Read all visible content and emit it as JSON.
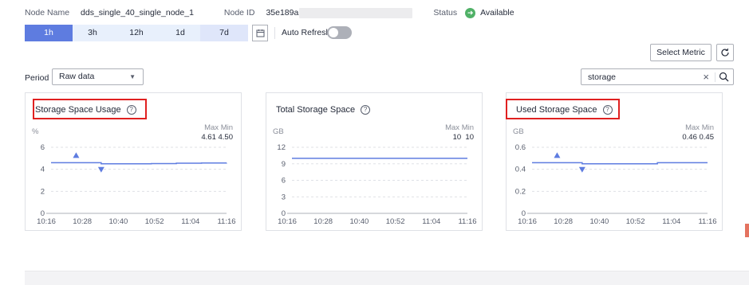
{
  "node": {
    "name_label": "Node Name",
    "name_value": "dds_single_40_single_node_1",
    "id_label": "Node ID",
    "id_value": "35e189a",
    "status_label": "Status",
    "status_value": "Available",
    "status_color": "#50b167"
  },
  "time_tabs": [
    {
      "label": "1h",
      "active": true
    },
    {
      "label": "3h",
      "active": false
    },
    {
      "label": "12h",
      "active": false
    },
    {
      "label": "1d",
      "active": false
    },
    {
      "label": "7d",
      "active": false
    }
  ],
  "auto_refresh": {
    "label": "Auto Refresh",
    "on": false
  },
  "toolbar": {
    "select_metric": "Select Metric",
    "refresh_icon": "refresh-icon"
  },
  "period": {
    "label": "Period",
    "value": "Raw data"
  },
  "search": {
    "value": "storage"
  },
  "accent_color": "#5e7ce0",
  "highlight_color": "#e02020",
  "panels": [
    {
      "title": "Storage Space Usage",
      "highlighted": true,
      "unit": "%",
      "max_label": "Max",
      "min_label": "Min",
      "max": "4.61",
      "min": "4.50",
      "chart_data": {
        "type": "line",
        "x_ticks": [
          "10:16",
          "10:28",
          "10:40",
          "10:52",
          "11:04",
          "11:16"
        ],
        "y_ticks": [
          "0",
          "2",
          "4",
          "6"
        ],
        "ylim": [
          0,
          6
        ],
        "series": [
          {
            "values": [
              4.6,
              4.6,
              4.5,
              4.5,
              4.52,
              4.55,
              4.57,
              4.58
            ]
          }
        ],
        "max_marker_index": 1,
        "min_marker_index": 2
      }
    },
    {
      "title": "Total Storage Space",
      "highlighted": false,
      "unit": "GB",
      "max_label": "Max",
      "min_label": "Min",
      "max": "10",
      "min": "10",
      "chart_data": {
        "type": "line",
        "x_ticks": [
          "10:16",
          "10:28",
          "10:40",
          "10:52",
          "11:04",
          "11:16"
        ],
        "y_ticks": [
          "0",
          "3",
          "6",
          "9",
          "12"
        ],
        "ylim": [
          0,
          12
        ],
        "series": [
          {
            "values": [
              10,
              10,
              10,
              10,
              10,
              10,
              10,
              10
            ]
          }
        ],
        "max_marker_index": null,
        "min_marker_index": null
      }
    },
    {
      "title": "Used Storage Space",
      "highlighted": true,
      "unit": "GB",
      "max_label": "Max",
      "min_label": "Min",
      "max": "0.46",
      "min": "0.45",
      "chart_data": {
        "type": "line",
        "x_ticks": [
          "10:16",
          "10:28",
          "10:40",
          "10:52",
          "11:04",
          "11:16"
        ],
        "y_ticks": [
          "0",
          "0.2",
          "0.4",
          "0.6"
        ],
        "ylim": [
          0,
          0.6
        ],
        "series": [
          {
            "values": [
              0.46,
              0.46,
              0.45,
              0.45,
              0.45,
              0.46,
              0.46,
              0.46
            ]
          }
        ],
        "max_marker_index": 1,
        "min_marker_index": 2
      }
    }
  ]
}
